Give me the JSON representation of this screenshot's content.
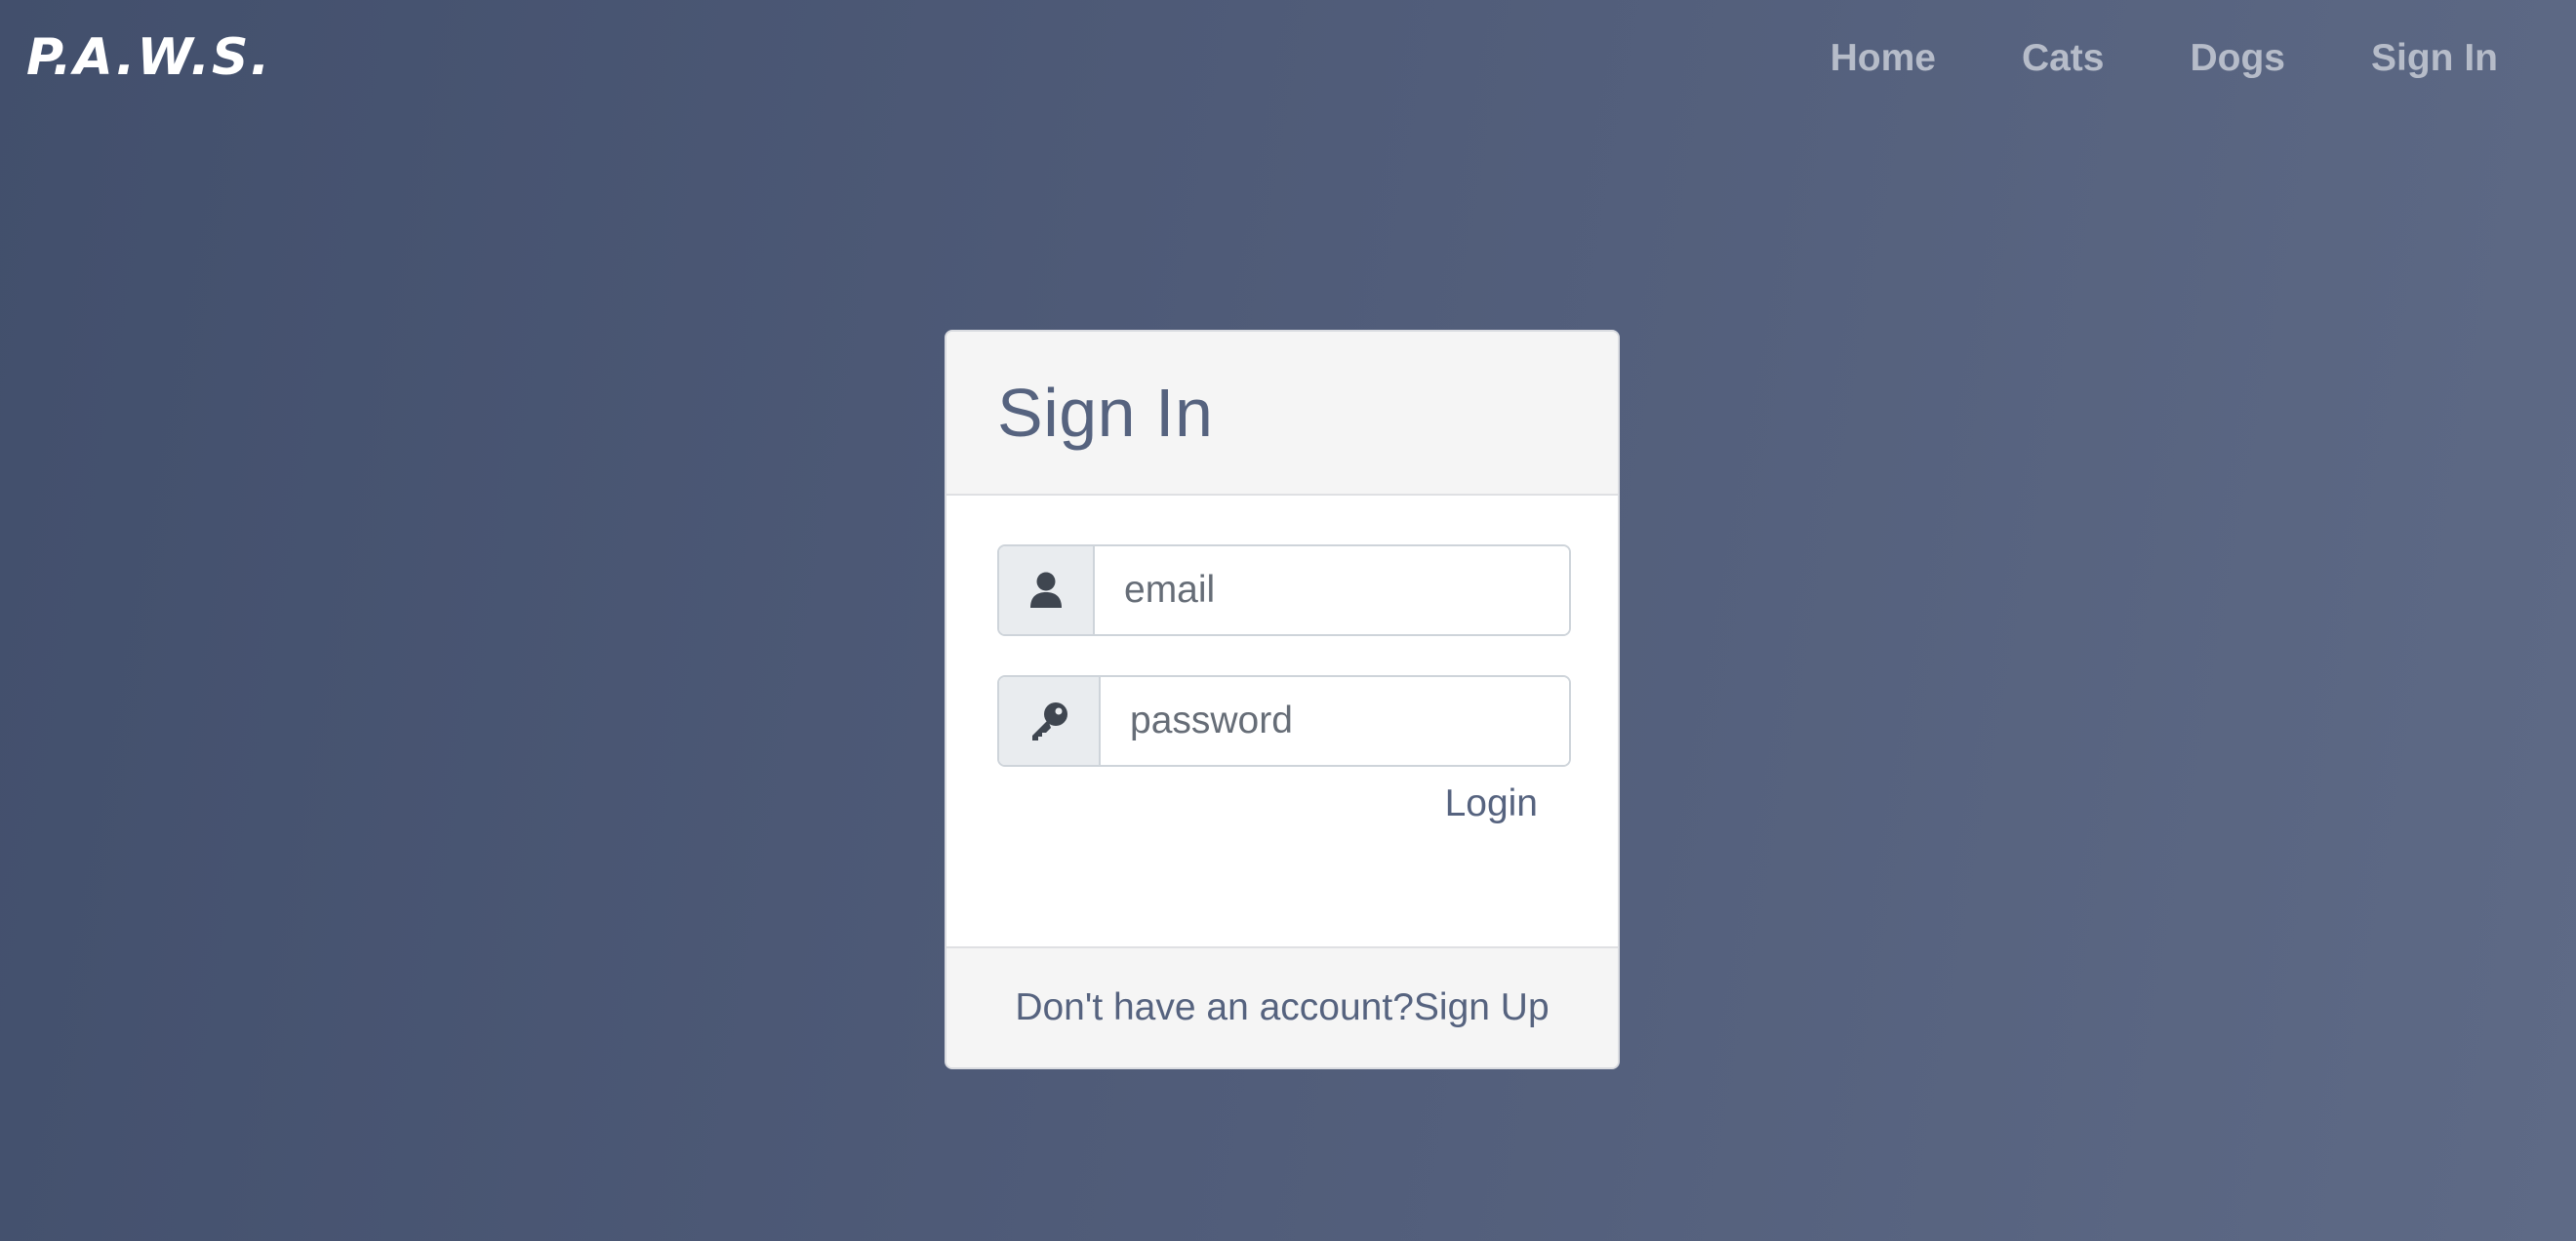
{
  "brand": {
    "name": "P.A.W.S."
  },
  "nav": {
    "items": [
      {
        "label": "Home"
      },
      {
        "label": "Cats"
      },
      {
        "label": "Dogs"
      },
      {
        "label": "Sign In"
      }
    ]
  },
  "signin": {
    "title": "Sign In",
    "email": {
      "placeholder": "email",
      "value": "",
      "icon": "user-icon"
    },
    "password": {
      "placeholder": "password",
      "value": "",
      "icon": "key-icon"
    },
    "login_label": "Login",
    "footer": {
      "prompt": "Don't have an account?",
      "signup_label": "Sign Up"
    }
  },
  "colors": {
    "accent": "#56637f",
    "nav_text": "#b6bcc9",
    "background_start": "#424f6c",
    "background_end": "#5e6a86"
  }
}
